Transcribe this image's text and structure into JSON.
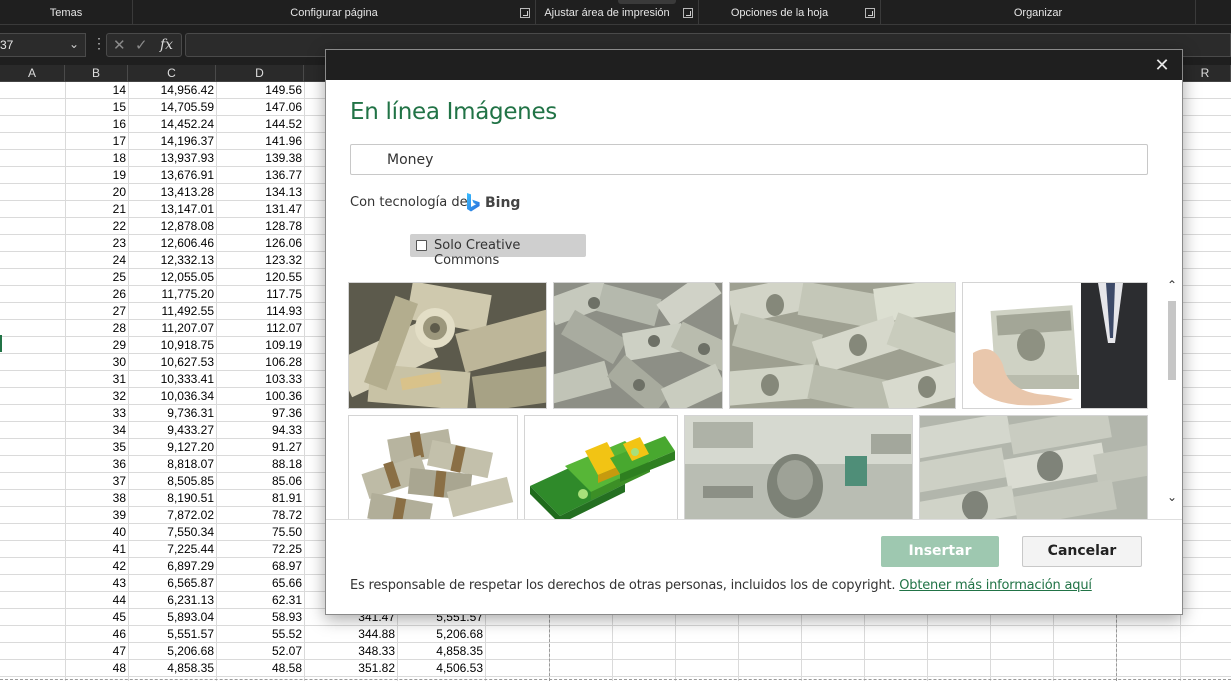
{
  "ribbon": {
    "groups": [
      {
        "label": "Temas"
      },
      {
        "label": "Configurar página"
      },
      {
        "label": "Ajustar área de impresión"
      },
      {
        "label": "Opciones de la hoja"
      },
      {
        "label": "Organizar"
      }
    ]
  },
  "formula_bar": {
    "name_box": "37",
    "formula": ""
  },
  "columns": [
    "A",
    "B",
    "C",
    "D",
    "R"
  ],
  "rows": [
    {
      "b": "14",
      "c": "14,956.42",
      "d": "149.56"
    },
    {
      "b": "15",
      "c": "14,705.59",
      "d": "147.06"
    },
    {
      "b": "16",
      "c": "14,452.24",
      "d": "144.52"
    },
    {
      "b": "17",
      "c": "14,196.37",
      "d": "141.96"
    },
    {
      "b": "18",
      "c": "13,937.93",
      "d": "139.38"
    },
    {
      "b": "19",
      "c": "13,676.91",
      "d": "136.77"
    },
    {
      "b": "20",
      "c": "13,413.28",
      "d": "134.13"
    },
    {
      "b": "21",
      "c": "13,147.01",
      "d": "131.47"
    },
    {
      "b": "22",
      "c": "12,878.08",
      "d": "128.78"
    },
    {
      "b": "23",
      "c": "12,606.46",
      "d": "126.06"
    },
    {
      "b": "24",
      "c": "12,332.13",
      "d": "123.32"
    },
    {
      "b": "25",
      "c": "12,055.05",
      "d": "120.55"
    },
    {
      "b": "26",
      "c": "11,775.20",
      "d": "117.75"
    },
    {
      "b": "27",
      "c": "11,492.55",
      "d": "114.93"
    },
    {
      "b": "28",
      "c": "11,207.07",
      "d": "112.07"
    },
    {
      "b": "29",
      "c": "10,918.75",
      "d": "109.19"
    },
    {
      "b": "30",
      "c": "10,627.53",
      "d": "106.28"
    },
    {
      "b": "31",
      "c": "10,333.41",
      "d": "103.33"
    },
    {
      "b": "32",
      "c": "10,036.34",
      "d": "100.36"
    },
    {
      "b": "33",
      "c": "9,736.31",
      "d": "97.36"
    },
    {
      "b": "34",
      "c": "9,433.27",
      "d": "94.33"
    },
    {
      "b": "35",
      "c": "9,127.20",
      "d": "91.27"
    },
    {
      "b": "36",
      "c": "8,818.07",
      "d": "88.18"
    },
    {
      "b": "37",
      "c": "8,505.85",
      "d": "85.06"
    },
    {
      "b": "38",
      "c": "8,190.51",
      "d": "81.91"
    },
    {
      "b": "39",
      "c": "7,872.02",
      "d": "78.72"
    },
    {
      "b": "40",
      "c": "7,550.34",
      "d": "75.50"
    },
    {
      "b": "41",
      "c": "7,225.44",
      "d": "72.25"
    },
    {
      "b": "42",
      "c": "6,897.29",
      "d": "68.97"
    },
    {
      "b": "43",
      "c": "6,565.87",
      "d": "65.66"
    },
    {
      "b": "44",
      "c": "6,231.13",
      "d": "62.31"
    },
    {
      "b": "45",
      "c": "5,893.04",
      "d": "58.93",
      "e": "341.47",
      "f": "5,551.57"
    },
    {
      "b": "46",
      "c": "5,551.57",
      "d": "55.52",
      "e": "344.88",
      "f": "5,206.68"
    },
    {
      "b": "47",
      "c": "5,206.68",
      "d": "52.07",
      "e": "348.33",
      "f": "4,858.35"
    },
    {
      "b": "48",
      "c": "4,858.35",
      "d": "48.58",
      "e": "351.82",
      "f": "4,506.53"
    }
  ],
  "dialog": {
    "title": "En línea Imágenes",
    "search_value": "Money",
    "powered_by": "Con tecnología de",
    "bing_label": "Bing",
    "cc_label": "Solo Creative Commons",
    "cc_checked": false,
    "insert_label": "Insertar",
    "cancel_label": "Cancelar",
    "footer_text": "Es responsable de respetar los derechos de otras personas, incluidos los de copyright.",
    "footer_link": "Obtener más información aquí",
    "accent_color": "#217346",
    "results": [
      {
        "name": "rolled-dollar-bills"
      },
      {
        "name": "scattered-mixed-bills"
      },
      {
        "name": "scattered-hundred-bills"
      },
      {
        "name": "hand-holding-stack"
      },
      {
        "name": "bundled-stacks-pile"
      },
      {
        "name": "green-cash-stacks-clipart"
      },
      {
        "name": "hundred-dollar-closeup"
      },
      {
        "name": "hundred-dollar-rows"
      }
    ]
  }
}
